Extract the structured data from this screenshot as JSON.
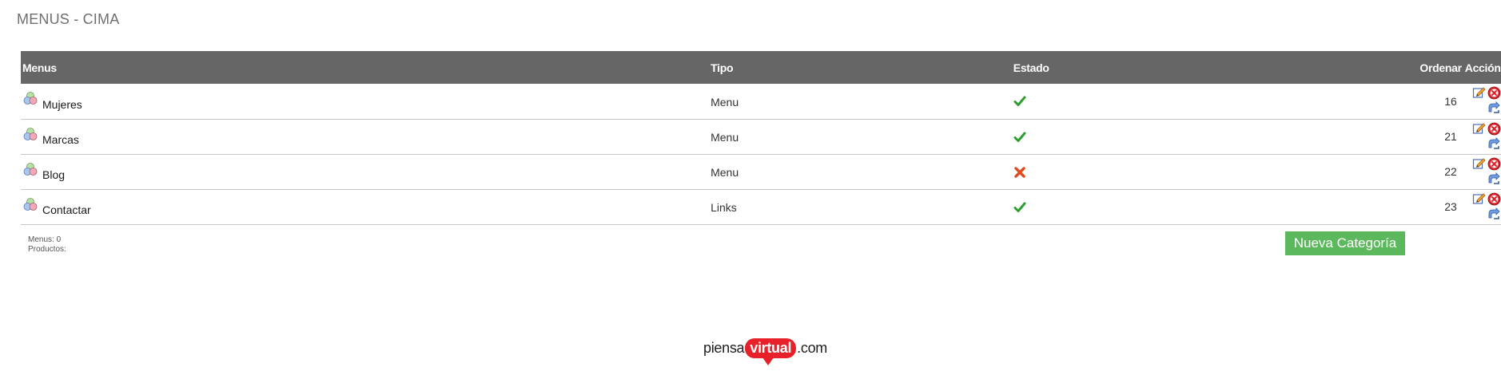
{
  "page": {
    "title": "MENUS - CIMA"
  },
  "table": {
    "headers": {
      "menus": "Menus",
      "tipo": "Tipo",
      "estado": "Estado",
      "ordenar": "Ordenar",
      "accion": "Acción"
    },
    "rows": [
      {
        "name": "Mujeres",
        "tipo": "Menu",
        "estado": "active",
        "orden": "16"
      },
      {
        "name": "Marcas",
        "tipo": "Menu",
        "estado": "active",
        "orden": "21"
      },
      {
        "name": "Blog",
        "tipo": "Menu",
        "estado": "inactive",
        "orden": "22"
      },
      {
        "name": "Contactar",
        "tipo": "Links",
        "estado": "active",
        "orden": "23"
      }
    ]
  },
  "stats": {
    "menus": "Menus: 0",
    "productos": "Productos:"
  },
  "actions": {
    "new_category": "Nueva Categoría"
  },
  "footer": {
    "brand_prefix": "piensa",
    "brand_highlight": "virtual",
    "brand_suffix": ".com"
  },
  "colors": {
    "header_bg": "#666666",
    "accent_green": "#5cb85c",
    "check_green": "#2e9e2e",
    "cross_red": "#e04a1e",
    "brand_red": "#e8202a"
  },
  "icons": {
    "row": "menu-circles-icon",
    "active": "check-icon",
    "inactive": "cross-icon",
    "edit": "edit-icon",
    "delete": "delete-icon",
    "move": "move-icon"
  }
}
